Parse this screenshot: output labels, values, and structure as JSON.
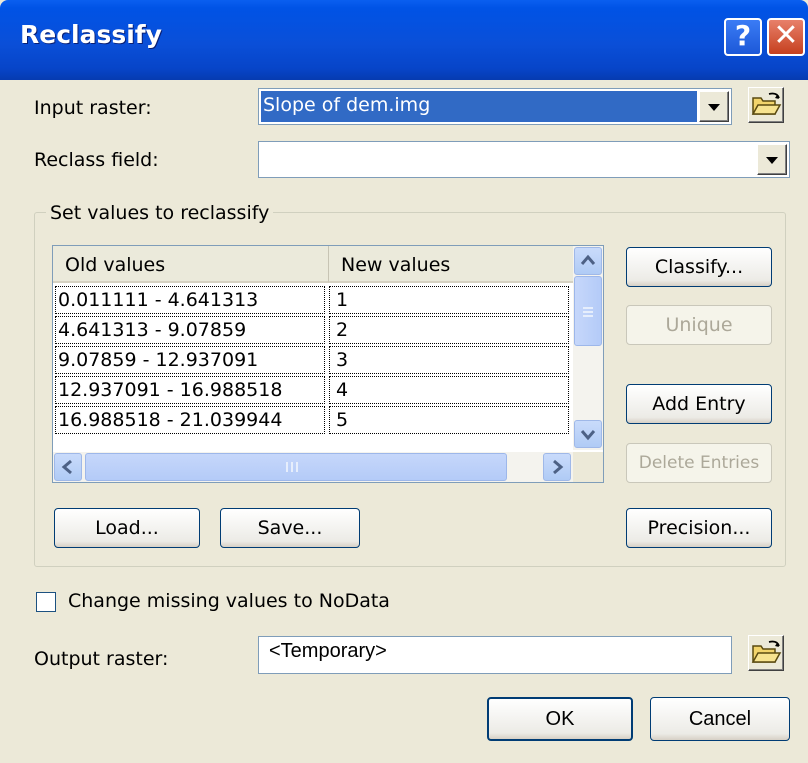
{
  "window": {
    "title": "Reclassify"
  },
  "titlebar": {
    "help_glyph": "?",
    "close_glyph": "✕"
  },
  "input_raster": {
    "label": "Input raster:",
    "value": "Slope of dem.img"
  },
  "reclass_field": {
    "label": "Reclass field:",
    "value": ""
  },
  "group": {
    "label": "Set values to reclassify"
  },
  "table": {
    "columns": [
      "Old values",
      "New values"
    ],
    "rows": [
      {
        "old": "0.011111 - 4.641313",
        "new": "1"
      },
      {
        "old": "4.641313 - 9.07859",
        "new": "2"
      },
      {
        "old": "9.07859 - 12.937091",
        "new": "3"
      },
      {
        "old": "12.937091 - 16.988518",
        "new": "4"
      },
      {
        "old": "16.988518 - 21.039944",
        "new": "5"
      }
    ]
  },
  "buttons": {
    "classify": "Classify...",
    "unique": "Unique",
    "add_entry": "Add Entry",
    "delete_entries": "Delete Entries",
    "load": "Load...",
    "save": "Save...",
    "precision": "Precision...",
    "ok": "OK",
    "cancel": "Cancel"
  },
  "missing": {
    "label": "Change missing values to NoData",
    "checked": false
  },
  "output_raster": {
    "label": "Output raster:",
    "value": "<Temporary>"
  },
  "icons": {
    "help": "help-icon",
    "close": "close-icon",
    "folder": "open-folder-icon",
    "dropdown": "chevron-down-icon"
  },
  "colors": {
    "titlebar": "#0053e6",
    "selection": "#316ac5",
    "dialog_bg": "#ece9d8"
  }
}
